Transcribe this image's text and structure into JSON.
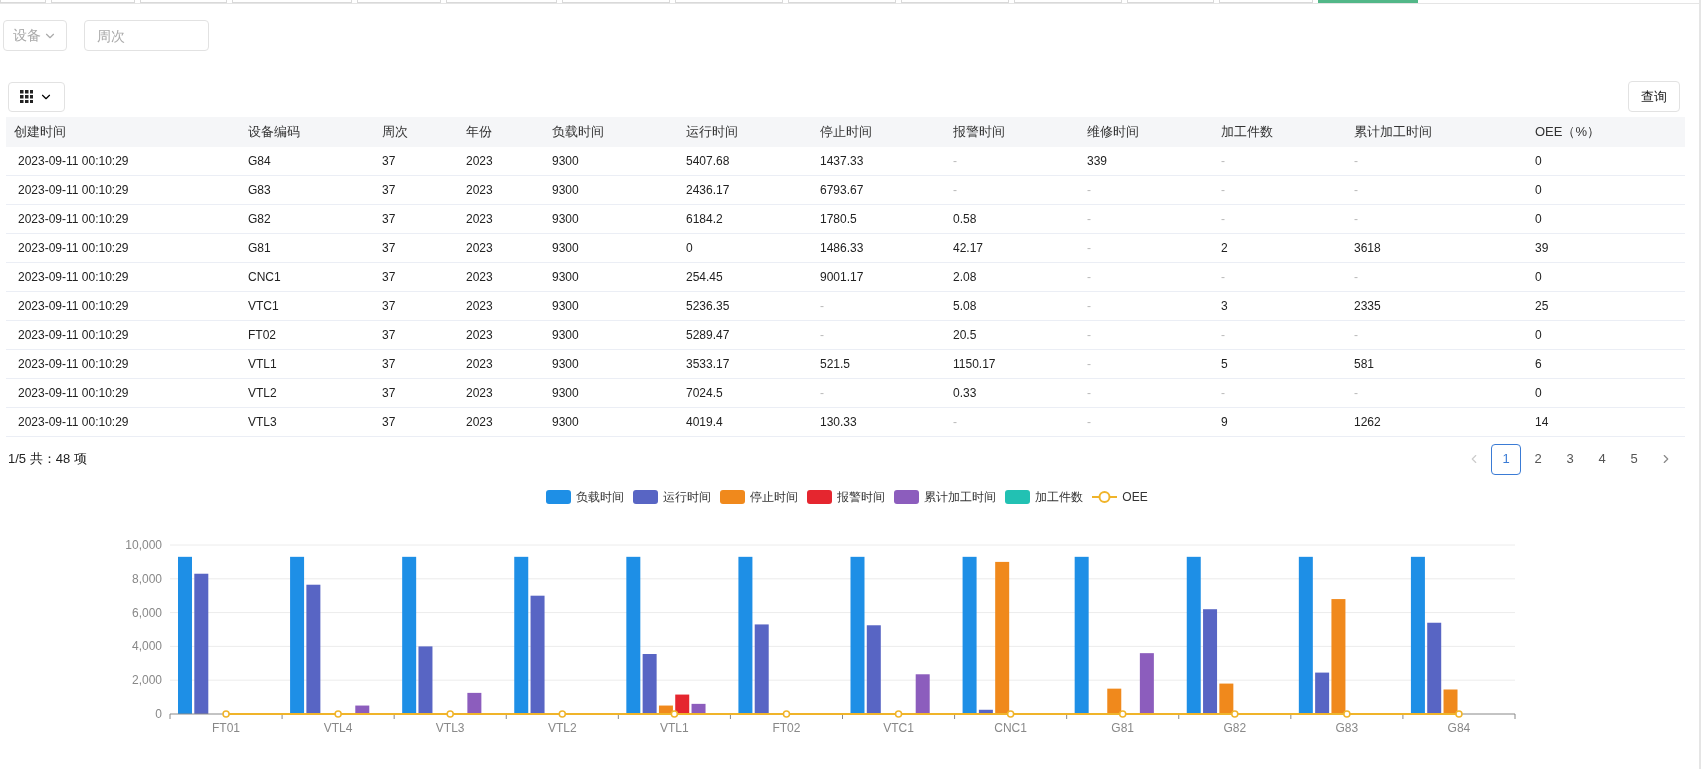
{
  "top_tabs": [
    {
      "selected": false
    },
    {
      "selected": false
    },
    {
      "selected": false
    },
    {
      "selected": false
    },
    {
      "selected": false
    },
    {
      "selected": false
    },
    {
      "selected": false
    },
    {
      "selected": false
    },
    {
      "selected": false
    },
    {
      "selected": false
    },
    {
      "selected": false
    },
    {
      "selected": false
    },
    {
      "selected": false
    },
    {
      "selected": true
    }
  ],
  "filters": {
    "device_select": {
      "placeholder": "设备"
    },
    "week_field": {
      "placeholder": "周次"
    }
  },
  "query_button": "查询",
  "table": {
    "columns": [
      "创建时间",
      "设备编码",
      "周次",
      "年份",
      "负载时间",
      "运行时间",
      "停止时间",
      "报警时间",
      "维修时间",
      "加工件数",
      "累计加工时间",
      "OEE（%）"
    ],
    "rows": [
      [
        "2023-09-11 00:10:29",
        "G84",
        "37",
        "2023",
        "9300",
        "5407.68",
        "1437.33",
        {
          "text": "-",
          "muted": true
        },
        "339",
        {
          "text": "-",
          "muted": true
        },
        {
          "text": "-",
          "muted": true
        },
        "0"
      ],
      [
        "2023-09-11 00:10:29",
        "G83",
        "37",
        "2023",
        "9300",
        "2436.17",
        "6793.67",
        {
          "text": "-",
          "muted": true
        },
        {
          "text": "-",
          "muted": true
        },
        {
          "text": "-",
          "muted": true
        },
        {
          "text": "-",
          "muted": true
        },
        "0"
      ],
      [
        "2023-09-11 00:10:29",
        "G82",
        "37",
        "2023",
        "9300",
        "6184.2",
        "1780.5",
        "0.58",
        {
          "text": "-",
          "muted": true
        },
        {
          "text": "-",
          "muted": true
        },
        {
          "text": "-",
          "muted": true
        },
        "0"
      ],
      [
        "2023-09-11 00:10:29",
        "G81",
        "37",
        "2023",
        "9300",
        "0",
        "1486.33",
        "42.17",
        {
          "text": "-",
          "muted": true
        },
        "2",
        "3618",
        "39"
      ],
      [
        "2023-09-11 00:10:29",
        "CNC1",
        "37",
        "2023",
        "9300",
        "254.45",
        "9001.17",
        "2.08",
        {
          "text": "-",
          "muted": true
        },
        {
          "text": "-",
          "muted": true
        },
        {
          "text": "-",
          "muted": true
        },
        "0"
      ],
      [
        "2023-09-11 00:10:29",
        "VTC1",
        "37",
        "2023",
        "9300",
        "5236.35",
        {
          "text": "-",
          "muted": true
        },
        "5.08",
        {
          "text": "-",
          "muted": true
        },
        "3",
        "2335",
        "25"
      ],
      [
        "2023-09-11 00:10:29",
        "FT02",
        "37",
        "2023",
        "9300",
        "5289.47",
        {
          "text": "-",
          "muted": true
        },
        "20.5",
        {
          "text": "-",
          "muted": true
        },
        {
          "text": "-",
          "muted": true
        },
        {
          "text": "-",
          "muted": true
        },
        "0"
      ],
      [
        "2023-09-11 00:10:29",
        "VTL1",
        "37",
        "2023",
        "9300",
        "3533.17",
        "521.5",
        "1150.17",
        {
          "text": "-",
          "muted": true
        },
        "5",
        "581",
        "6"
      ],
      [
        "2023-09-11 00:10:29",
        "VTL2",
        "37",
        "2023",
        "9300",
        "7024.5",
        {
          "text": "-",
          "muted": true
        },
        "0.33",
        {
          "text": "-",
          "muted": true
        },
        {
          "text": "-",
          "muted": true
        },
        {
          "text": "-",
          "muted": true
        },
        "0"
      ],
      [
        "2023-09-11 00:10:29",
        "VTL3",
        "37",
        "2023",
        "9300",
        "4019.4",
        "130.33",
        {
          "text": "-",
          "muted": true
        },
        {
          "text": "-",
          "muted": true
        },
        "9",
        "1262",
        "14"
      ]
    ]
  },
  "pagination": {
    "summary": "1/5 共：48 项",
    "prev_disabled": true,
    "pages": [
      {
        "label": "1",
        "selected": true
      },
      {
        "label": "2",
        "selected": false
      },
      {
        "label": "3",
        "selected": false
      },
      {
        "label": "4",
        "selected": false
      },
      {
        "label": "5",
        "selected": false
      }
    ]
  },
  "chart": {
    "chart_data": {
      "type": "bar",
      "categories": [
        "FT01",
        "VTL4",
        "VTL3",
        "VTL2",
        "VTL1",
        "FT02",
        "VTC1",
        "CNC1",
        "G81",
        "G82",
        "G83",
        "G84"
      ],
      "ylim": [
        0,
        10000
      ],
      "grid": true,
      "yticks": [
        {
          "value": 0,
          "label": "0"
        },
        {
          "value": 2000,
          "label": "2,000"
        },
        {
          "value": 4000,
          "label": "4,000"
        },
        {
          "value": 6000,
          "label": "6,000"
        },
        {
          "value": 8000,
          "label": "8,000"
        },
        {
          "value": 10000,
          "label": "10,000"
        }
      ],
      "series": [
        {
          "name": "负载时间",
          "color": "#1e8fe6",
          "values": [
            9300,
            9300,
            9300,
            9300,
            9300,
            9300,
            9300,
            9300,
            9300,
            9300,
            9300,
            9300
          ]
        },
        {
          "name": "运行时间",
          "color": "#5865c4",
          "values": [
            8300,
            7650,
            4000,
            7000,
            3550,
            5300,
            5250,
            250,
            null,
            6200,
            2450,
            5400
          ]
        },
        {
          "name": "停止时间",
          "color": "#f0891c",
          "values": [
            null,
            null,
            null,
            null,
            500,
            null,
            null,
            9000,
            1500,
            1800,
            6800,
            1450
          ]
        },
        {
          "name": "报警时间",
          "color": "#e5262f",
          "values": [
            null,
            null,
            null,
            null,
            1150,
            null,
            null,
            null,
            null,
            null,
            null,
            null
          ]
        },
        {
          "name": "累计加工时间",
          "color": "#8c5dbd",
          "values": [
            null,
            500,
            1250,
            null,
            600,
            null,
            2350,
            null,
            3600,
            null,
            null,
            null
          ]
        },
        {
          "name": "加工件数",
          "color": "#22c1b3",
          "values": [
            null,
            null,
            null,
            null,
            null,
            null,
            null,
            null,
            null,
            null,
            null,
            null
          ]
        },
        {
          "name": "OEE",
          "color": "#f0b42a",
          "type": "line",
          "marker": true,
          "values": [
            0,
            0,
            0,
            0,
            0,
            0,
            0,
            0,
            0,
            0,
            0,
            0
          ]
        }
      ]
    }
  }
}
